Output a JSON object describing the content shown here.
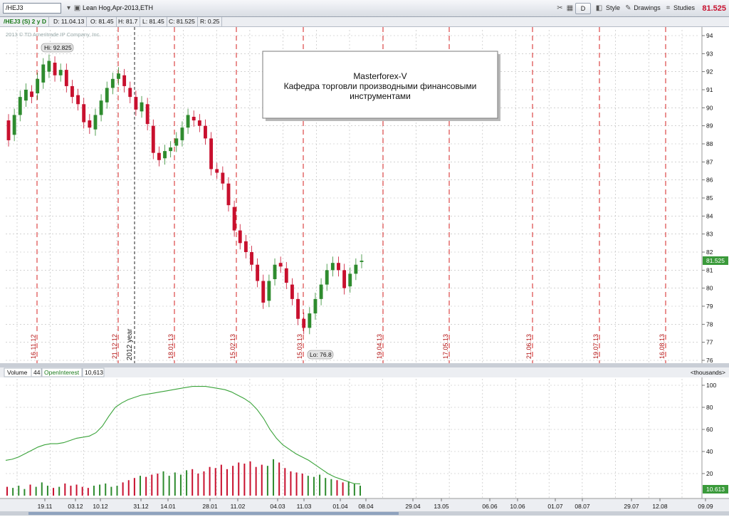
{
  "toolbar": {
    "symbol": "/HEJ3",
    "description": "Lean Hog,Apr-2013,ETH",
    "period_button": "D",
    "style_label": "Style",
    "drawings_label": "Drawings",
    "studies_label": "Studies",
    "last_price": "81.525",
    "icons": [
      "chevron-down-icon",
      "link-icon",
      "tools-icon",
      "chart-style-icon",
      "pencil-icon",
      "studies-icon"
    ]
  },
  "infobar": {
    "symbol_period": "/HEJ3 (S) 2 y D",
    "date": "D: 11.04.13",
    "open": "O: 81.45",
    "high": "H: 81.7",
    "low": "L: 81.45",
    "close": "C: 81.525",
    "range": "R: 0.25"
  },
  "watermark": "2013 © TD Ameritrade IP Company, Inc.",
  "annotation": {
    "line1": "Masterforex-V",
    "line2": "Кафедра торговли производными финансовыми",
    "line3": "инструментами"
  },
  "colors": {
    "up": "#2e8b2e",
    "down": "#c8102e",
    "vline": "#d42020",
    "grid": "#b8b8b8",
    "oi_line": "#3aa33a",
    "label_bg": "#3a9a3a"
  },
  "price_axis": {
    "ticks": [
      "76",
      "77",
      "78",
      "79",
      "80",
      "81",
      "82",
      "83",
      "84",
      "85",
      "86",
      "87",
      "88",
      "89",
      "90",
      "91",
      "92",
      "93",
      "94"
    ],
    "current_label": "81.525"
  },
  "markers": {
    "hi": "Hi: 92.825",
    "lo": "Lo: 76.8",
    "year": "2012 year"
  },
  "vline_labels": [
    "16.11.12",
    "21.12.12",
    "18.01.13",
    "15.02.13",
    "15.03.13",
    "19.04.13",
    "17.05.13",
    "21.06.13",
    "19.07.13",
    "16.08.13"
  ],
  "lower_pane": {
    "volume_label": "Volume",
    "volume_value": "44",
    "oi_label": "OpenInterest",
    "oi_value": "10,613",
    "units": "<thousands>",
    "axis_ticks": [
      "20",
      "40",
      "60",
      "80",
      "100"
    ],
    "current_label": "10.613"
  },
  "date_axis": [
    "19.11",
    "03.12",
    "10.12",
    "31.12",
    "14.01",
    "28.01",
    "11.02",
    "04.03",
    "11.03",
    "01.04",
    "08.04",
    "29.04",
    "13.05",
    "06.06",
    "10.06",
    "01.07",
    "08.07",
    "29.07",
    "12.08",
    "09.09"
  ],
  "chart_data": {
    "type": "candlestick",
    "title": "Lean Hog,Apr-2013,ETH",
    "ylim": [
      76,
      94
    ],
    "hi": 92.825,
    "lo": 76.8,
    "last": 81.525,
    "candles": [
      [
        89.3,
        88.2
      ],
      [
        88.5,
        89.6
      ],
      [
        89.6,
        90.6
      ],
      [
        90.4,
        91.0
      ],
      [
        90.9,
        90.6
      ],
      [
        90.8,
        91.6
      ],
      [
        91.4,
        92.4
      ],
      [
        92.0,
        92.6
      ],
      [
        92.5,
        91.8
      ],
      [
        91.8,
        92.1
      ],
      [
        92.1,
        91.2
      ],
      [
        91.2,
        90.6
      ],
      [
        90.7,
        90.2
      ],
      [
        90.2,
        89.2
      ],
      [
        89.3,
        88.9
      ],
      [
        88.8,
        89.6
      ],
      [
        89.6,
        90.4
      ],
      [
        90.3,
        91.1
      ],
      [
        91.1,
        91.6
      ],
      [
        91.6,
        91.9
      ],
      [
        91.8,
        91.2
      ],
      [
        91.1,
        90.6
      ],
      [
        90.6,
        89.9
      ],
      [
        89.8,
        90.3
      ],
      [
        90.2,
        89.1
      ],
      [
        89.0,
        87.5
      ],
      [
        87.5,
        87.1
      ],
      [
        87.2,
        87.6
      ],
      [
        87.6,
        87.8
      ],
      [
        87.9,
        88.3
      ],
      [
        88.2,
        88.9
      ],
      [
        88.9,
        89.6
      ],
      [
        89.5,
        89.3
      ],
      [
        89.3,
        89.0
      ],
      [
        89.0,
        88.3
      ],
      [
        88.3,
        86.6
      ],
      [
        86.6,
        86.4
      ],
      [
        86.4,
        85.8
      ],
      [
        85.8,
        84.6
      ],
      [
        84.5,
        83.2
      ],
      [
        83.2,
        82.5
      ],
      [
        82.6,
        82.0
      ],
      [
        82.0,
        81.3
      ],
      [
        81.3,
        80.4
      ],
      [
        80.4,
        79.2
      ],
      [
        79.3,
        80.4
      ],
      [
        80.5,
        81.3
      ],
      [
        81.4,
        81.2
      ],
      [
        81.1,
        80.3
      ],
      [
        80.2,
        79.4
      ],
      [
        79.4,
        78.3
      ],
      [
        78.3,
        77.8
      ],
      [
        77.8,
        78.6
      ],
      [
        78.6,
        79.4
      ],
      [
        79.4,
        80.2
      ],
      [
        80.2,
        81.0
      ],
      [
        81.0,
        81.4
      ],
      [
        81.4,
        81.0
      ],
      [
        81.0,
        80.0
      ],
      [
        80.1,
        80.8
      ],
      [
        80.8,
        81.3
      ],
      [
        81.45,
        81.525
      ]
    ],
    "volume": [
      8,
      7,
      9,
      6,
      10,
      8,
      12,
      9,
      7,
      8,
      11,
      9,
      10,
      8,
      7,
      9,
      10,
      11,
      8,
      9,
      12,
      14,
      16,
      18,
      17,
      19,
      20,
      22,
      18,
      21,
      19,
      23,
      24,
      20,
      22,
      26,
      25,
      28,
      24,
      27,
      30,
      29,
      31,
      26,
      28,
      27,
      33,
      30,
      25,
      22,
      21,
      20,
      18,
      17,
      19,
      16,
      15,
      14,
      12,
      13,
      11,
      9
    ],
    "open_interest": [
      32,
      33,
      35,
      38,
      41,
      44,
      46,
      47,
      47,
      48,
      50,
      52,
      53,
      54,
      57,
      63,
      72,
      80,
      84,
      87,
      89,
      91,
      92,
      93,
      94,
      95,
      96,
      97,
      98,
      99,
      99,
      99,
      98,
      97,
      96,
      94,
      91,
      88,
      84,
      78,
      70,
      60,
      52,
      46,
      42,
      38,
      35,
      32,
      28,
      24,
      20,
      17,
      15,
      13,
      11,
      10.6
    ]
  }
}
